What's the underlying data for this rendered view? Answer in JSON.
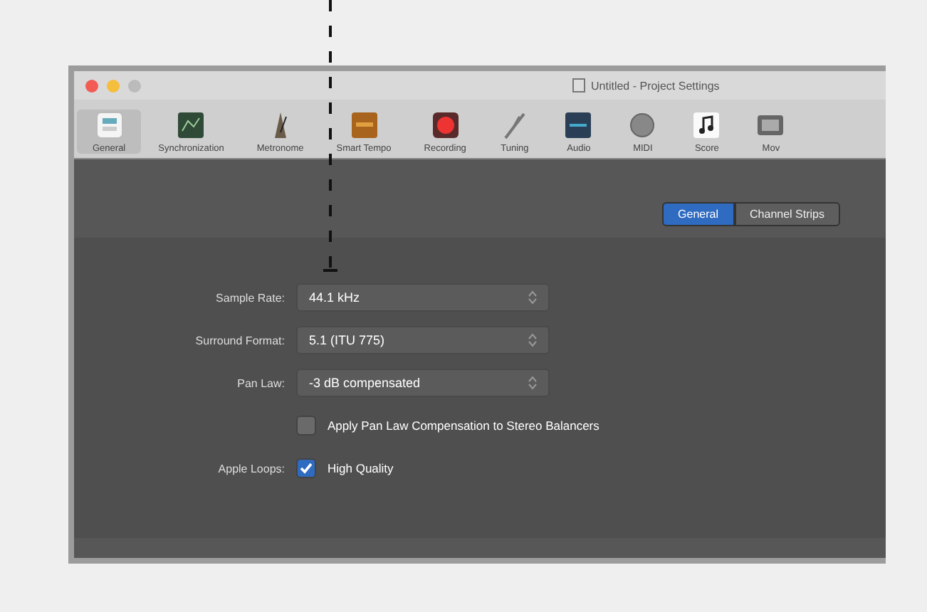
{
  "window": {
    "title": "Untitled - Project Settings"
  },
  "toolbar": [
    {
      "label": "General",
      "selected": true
    },
    {
      "label": "Synchronization",
      "selected": false
    },
    {
      "label": "Metronome",
      "selected": false
    },
    {
      "label": "Smart Tempo",
      "selected": false
    },
    {
      "label": "Recording",
      "selected": false
    },
    {
      "label": "Tuning",
      "selected": false
    },
    {
      "label": "Audio",
      "selected": false
    },
    {
      "label": "MIDI",
      "selected": false
    },
    {
      "label": "Score",
      "selected": false
    },
    {
      "label": "Mov",
      "selected": false
    }
  ],
  "tabs": [
    {
      "label": "General",
      "selected": true
    },
    {
      "label": "Channel Strips",
      "selected": false
    }
  ],
  "settings": [
    {
      "kind": "popup",
      "label": "Sample Rate:",
      "value": "44.1 kHz"
    },
    {
      "kind": "popup",
      "label": "Surround Format:",
      "value": "5.1 (ITU 775)"
    },
    {
      "kind": "popup",
      "label": "Pan Law:",
      "value": "-3 dB compensated"
    },
    {
      "kind": "checkbox",
      "text": "Apply Pan Law Compensation to Stereo Balancers",
      "checked": false
    },
    {
      "kind": "checkbox",
      "label": "Apple Loops:",
      "text": "High Quality",
      "checked": true
    }
  ]
}
